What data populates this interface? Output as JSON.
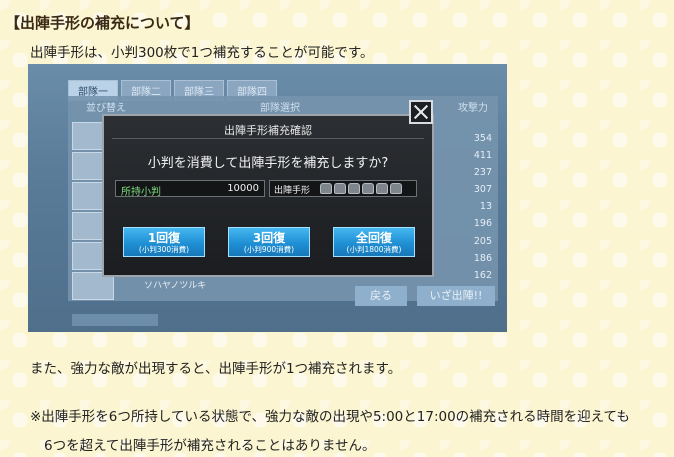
{
  "article": {
    "heading": "【出陣手形の補充について】",
    "intro": "出陣手形は、小判300枚で1つ補充することが可能です。",
    "strong_enemy": "また、強力な敵が出現すると、出陣手形が1つ補充されます。",
    "note_line1": "※出陣手形を6つ所持している状態で、強力な敵の出現や5:00と17:00の補充される時間を迎えても",
    "note_line2": "6つを超えて出陣手形が補充されることはありません。"
  },
  "game": {
    "tabs": [
      "部隊一",
      "部隊二",
      "部隊三",
      "部隊四"
    ],
    "list_headers": {
      "left": "並び替え",
      "center": "部隊選択",
      "right": "攻撃力"
    },
    "powers": [
      "354",
      "411",
      "237",
      "307",
      "13",
      "196",
      "205",
      "186",
      "162"
    ],
    "character_name": "ソハヤノツルキ",
    "buttons": {
      "back": "戻る",
      "go": "いざ出陣!!"
    }
  },
  "dialog": {
    "title": "出陣手形補充確認",
    "question": "小判を消費して出陣手形を補充しますか?",
    "coins_label": "所持小判",
    "coins_value": "10000",
    "pass_label": "出陣手形",
    "pass_icon_count": 6,
    "options": [
      {
        "main": "1回復",
        "sub": "(小判300消費)"
      },
      {
        "main": "3回復",
        "sub": "(小判900消費)"
      },
      {
        "main": "全回復",
        "sub": "(小判1800消費)"
      }
    ]
  },
  "colors": {
    "page_bg": "#fbf5d2",
    "dialog_bg": "#1b1d20",
    "button_blue": "#1f8fd4",
    "coin_label_green": "#7fdd7f"
  }
}
